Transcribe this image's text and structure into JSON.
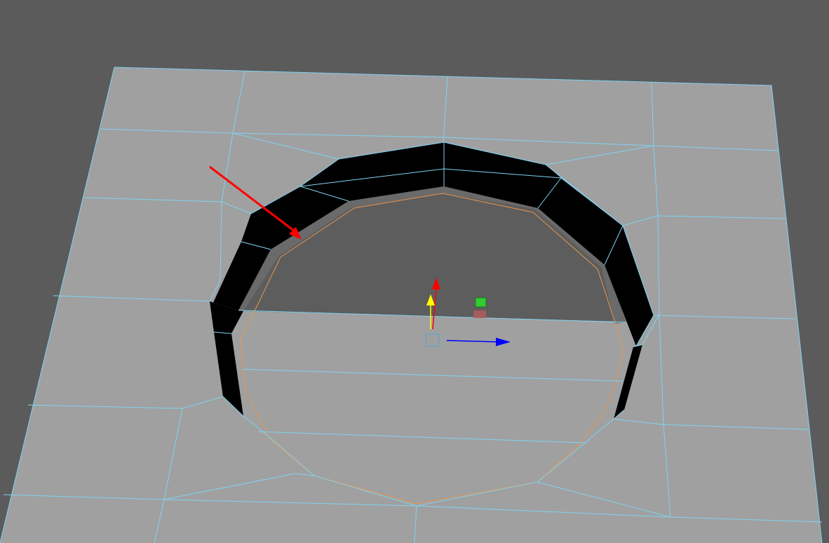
{
  "viewport": {
    "background_color": "#5b5b5b",
    "mesh_color": "#a0a0a0",
    "hole_interior_color": "#5d5d5d",
    "wireframe_color": "#7fd3f1",
    "bevel_face_color": "#000000",
    "selection_edge_color": "#e8964f",
    "annotation_arrow_color": "#ff0000"
  },
  "manipulator": {
    "pivot_icon": "pivot-square-icon",
    "x_axis_color": "#0000ff",
    "y_axis_color": "#ff0000",
    "y_axis_alt_color": "#ffff00",
    "z_axis_handle_color": "#33cc33",
    "scale_handle_color": "#b05a5a"
  }
}
